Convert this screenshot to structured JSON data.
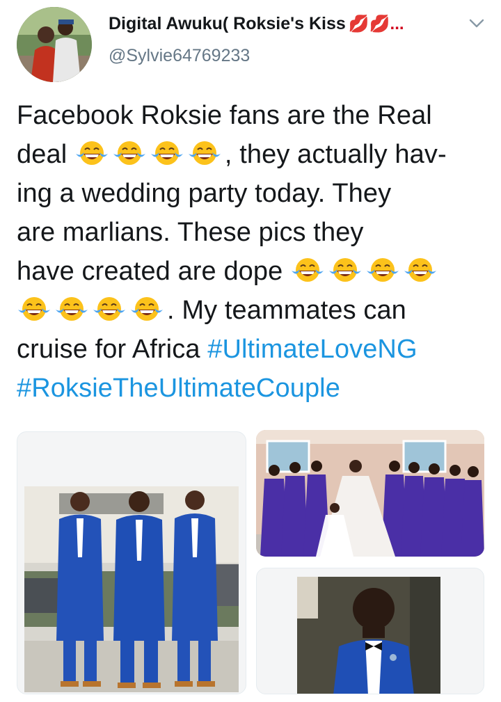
{
  "tweet": {
    "author_name": "Digital Awuku( Roksie's Kiss",
    "author_name_suffix": "💋💋...",
    "handle": "@Sylvie64769233",
    "lines": [
      {
        "parts": [
          {
            "t": "Facebook Roksie fans are the Real"
          }
        ]
      },
      {
        "parts": [
          {
            "t": "deal "
          },
          {
            "e": 4
          },
          {
            "t": ", they actually hav-"
          }
        ]
      },
      {
        "parts": [
          {
            "t": "ing a wedding party today. They"
          }
        ]
      },
      {
        "parts": [
          {
            "t": "are marlians. These pics they"
          }
        ]
      },
      {
        "parts": [
          {
            "t": "have created are dope "
          },
          {
            "e": 4
          }
        ]
      },
      {
        "parts": [
          {
            "e": 4
          },
          {
            "t": ". My teammates can"
          }
        ]
      },
      {
        "parts": [
          {
            "t": "cruise for Africa "
          },
          {
            "h": "#UltimateLoveNG"
          }
        ]
      },
      {
        "parts": [
          {
            "h": "#RoksieTheUltimateCouple"
          }
        ]
      }
    ]
  },
  "icons": {
    "menu": "chevron-down-icon",
    "emoji": "face-with-tears-of-joy-emoji"
  },
  "colors": {
    "link": "#1b95e0",
    "text": "#14171a",
    "secondary": "#657786",
    "suit_blue": "#1f4fb5",
    "dress_purple": "#4a2fa6"
  },
  "media": [
    {
      "name": "groomsmen-photo"
    },
    {
      "name": "bridal-party-photo"
    },
    {
      "name": "boy-in-suit-photo"
    }
  ]
}
